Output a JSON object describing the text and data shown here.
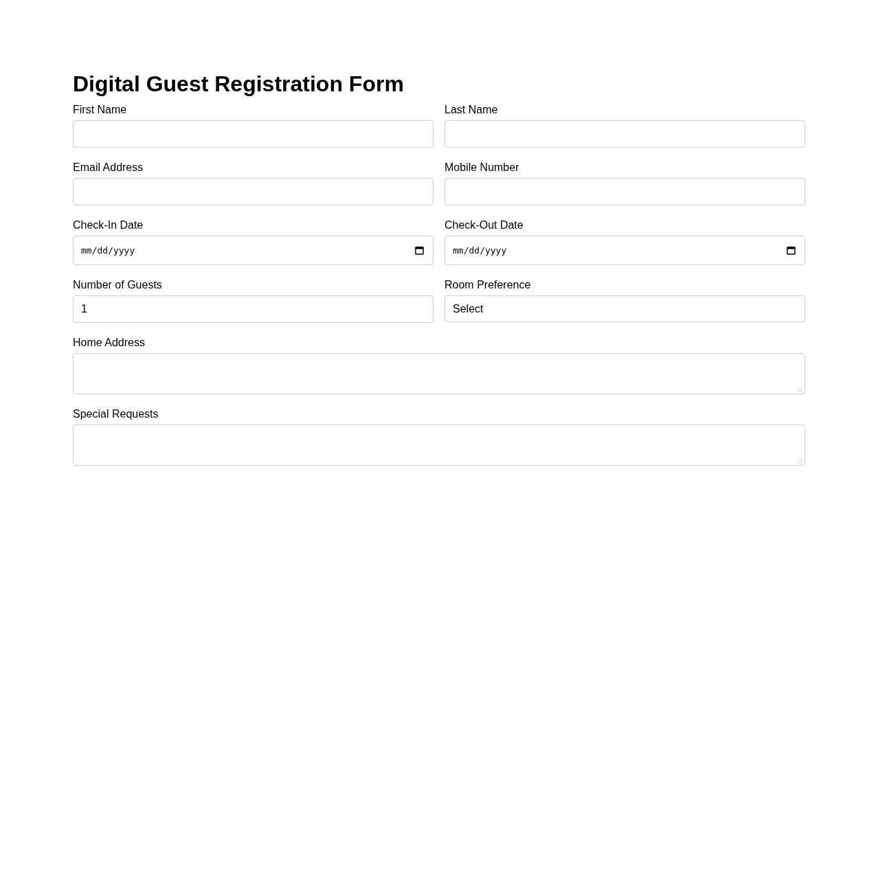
{
  "title": "Digital Guest Registration Form",
  "fields": [
    {
      "kind": "text",
      "label": "First Name"
    },
    {
      "kind": "text",
      "label": "Last Name"
    },
    {
      "kind": "text",
      "label": "Email Address"
    },
    {
      "kind": "text",
      "label": "Mobile Number"
    },
    {
      "kind": "date",
      "label": "Check-In Date",
      "placeholder": "mm/dd/yyyy"
    },
    {
      "kind": "date",
      "label": "Check-Out Date",
      "placeholder": "mm/dd/yyyy"
    },
    {
      "kind": "number",
      "label": "Number of Guests",
      "value": "1"
    },
    {
      "kind": "select",
      "label": "Room Preference",
      "value": "Select"
    },
    {
      "kind": "textarea",
      "label": "Home Address"
    },
    {
      "kind": "textarea",
      "label": "Special Requests"
    }
  ]
}
